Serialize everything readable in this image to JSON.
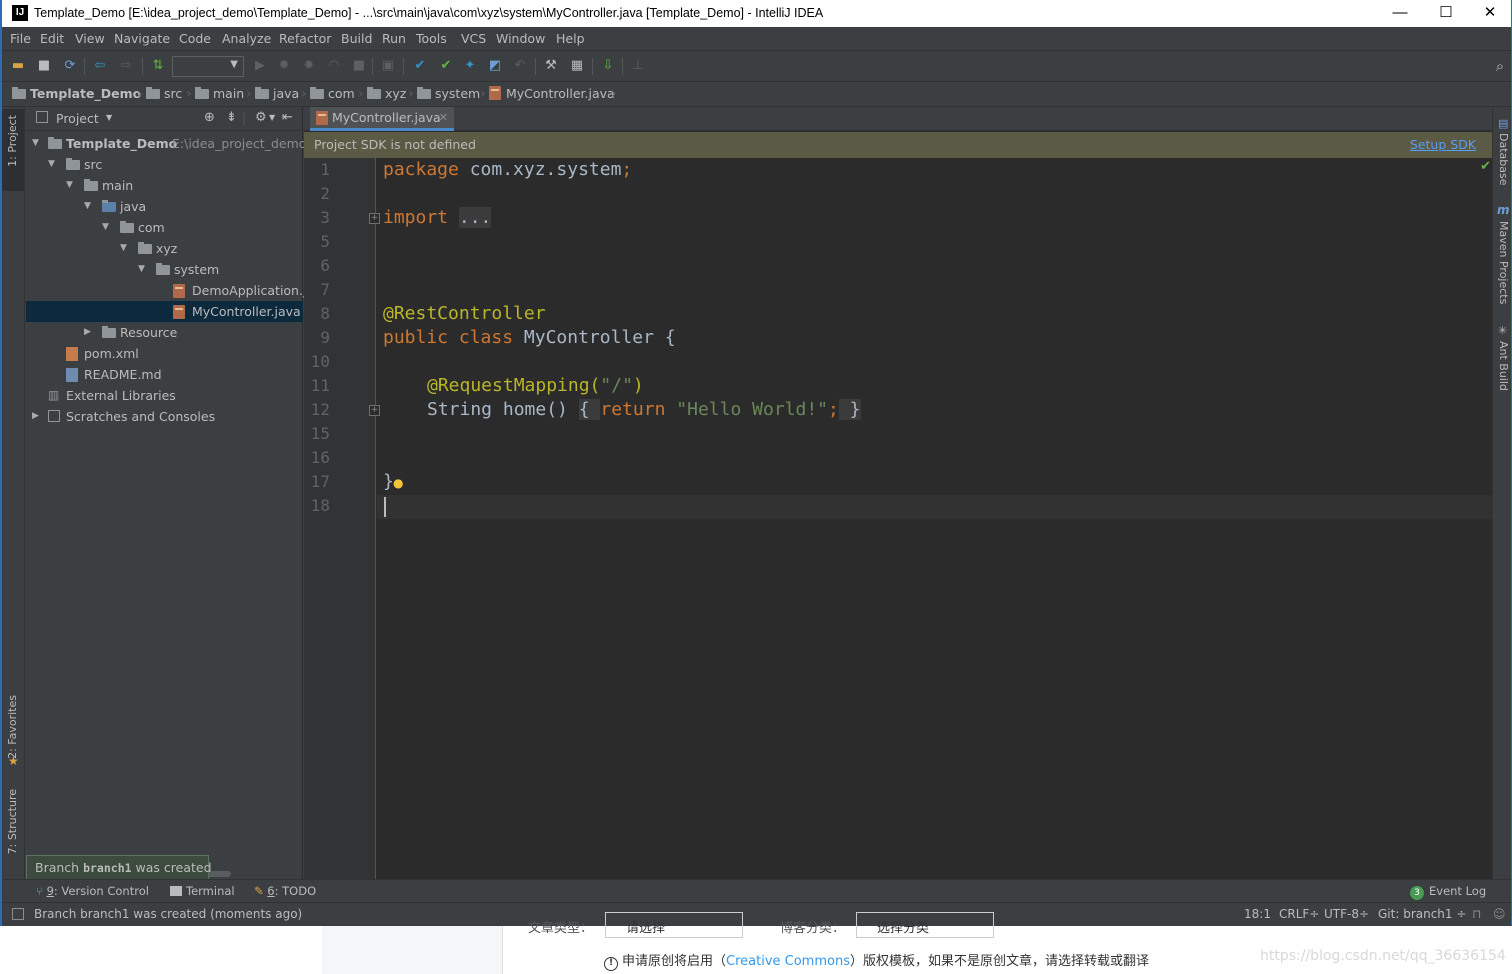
{
  "window": {
    "title": "Template_Demo [E:\\idea_project_demo\\Template_Demo] - ...\\src\\main\\java\\com\\xyz\\system\\MyController.java [Template_Demo] - IntelliJ IDEA",
    "logo_text": "IJ",
    "minimize": "—",
    "maximize": "☐",
    "close": "✕"
  },
  "menu": [
    "File",
    "Edit",
    "View",
    "Navigate",
    "Code",
    "Analyze",
    "Refactor",
    "Build",
    "Run",
    "Tools",
    "VCS",
    "Window",
    "Help"
  ],
  "breadcrumb": [
    "Template_Demo",
    "src",
    "main",
    "java",
    "com",
    "xyz",
    "system",
    "MyController.java"
  ],
  "left_stripe": {
    "project": "1: Project",
    "favorites": "2: Favorites",
    "structure": "7: Structure"
  },
  "project_panel": {
    "header": "Project",
    "tree": [
      {
        "label": "Template_Demo",
        "path": "E:\\idea_project_demo\\",
        "type": "module"
      },
      {
        "label": "src",
        "type": "folder"
      },
      {
        "label": "main",
        "type": "folder"
      },
      {
        "label": "java",
        "type": "folder"
      },
      {
        "label": "com",
        "type": "folder"
      },
      {
        "label": "xyz",
        "type": "folder"
      },
      {
        "label": "system",
        "type": "folder"
      },
      {
        "label": "DemoApplication.ja",
        "type": "java"
      },
      {
        "label": "MyController.java",
        "type": "java",
        "selected": true
      },
      {
        "label": "Resource",
        "type": "folder"
      },
      {
        "label": "pom.xml",
        "type": "xml"
      },
      {
        "label": "README.md",
        "type": "md"
      },
      {
        "label": "External Libraries",
        "type": "lib"
      },
      {
        "label": "Scratches and Consoles",
        "type": "scratch"
      }
    ]
  },
  "editor": {
    "tab": "MyController.java",
    "notification": "Project SDK is not defined",
    "notification_link": "Setup SDK",
    "line_numbers": [
      "1",
      "2",
      "3",
      "5",
      "6",
      "7",
      "8",
      "9",
      "10",
      "11",
      "12",
      "15",
      "16",
      "17",
      "18"
    ],
    "code": {
      "l1_kw": "package",
      "l1_rest": " com.xyz.system",
      "l1_semi": ";",
      "l3_kw": "import",
      "l3_fold": "...",
      "l8": "@RestController",
      "l9_kw1": "public",
      "l9_kw2": "class",
      "l9_rest": " MyController {",
      "l11_an": "@RequestMapping(",
      "l11_str": "\"/\"",
      "l11_end": ")",
      "l12_a": "String home() ",
      "l12_b": "{ ",
      "l12_kw": "return",
      "l12_str": "\"Hello World!\"",
      "l12_semi": ";",
      "l12_c": " }",
      "l17": "}"
    }
  },
  "right_stripe": {
    "database": "Database",
    "maven": "Maven Projects",
    "ant": "Ant Build"
  },
  "balloon": {
    "prefix": "Branch ",
    "branch": "branch1",
    "suffix": " was created"
  },
  "bottom_tabs": [
    {
      "key": "9",
      "label": ": Version Control"
    },
    {
      "key": "",
      "label": "Terminal"
    },
    {
      "key": "6",
      "label": ": TODO"
    }
  ],
  "event_log": {
    "badge": "3",
    "label": "Event Log"
  },
  "status": {
    "message": "Branch branch1 was created (moments ago)",
    "position": "18:1",
    "line_sep": "CRLF÷",
    "encoding": "UTF-8÷",
    "git": "Git: branch1 ÷"
  },
  "below_page": {
    "field1_label": "文章类型：",
    "field1_value": "请选择",
    "field2_label": "博客分类：",
    "field2_value": "选择分类",
    "license_prefix": "申请原创将启用（",
    "license_link": "Creative Commons",
    "license_suffix": "）版权模板，如果不是原创文章，请选择转载或翻译",
    "watermark": "https://blog.csdn.net/qq_36636154"
  },
  "colors": {
    "keyword": "#cc7832",
    "annotation": "#bbb529",
    "string": "#6a8759",
    "selection": "#0d293e",
    "link": "#589df6"
  }
}
